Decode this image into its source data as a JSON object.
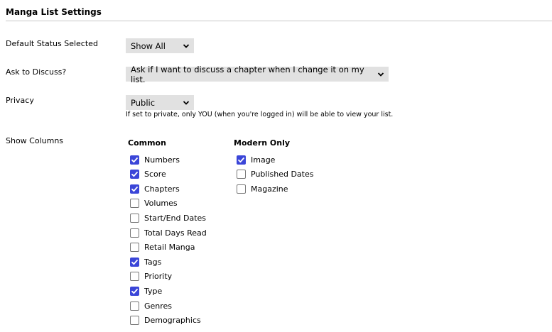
{
  "section_title": "Manga List Settings",
  "default_status": {
    "label": "Default Status Selected",
    "value": "Show All"
  },
  "ask_discuss": {
    "label": "Ask to Discuss?",
    "value": "Ask if I want to discuss a chapter when I change it on my list."
  },
  "privacy": {
    "label": "Privacy",
    "value": "Public",
    "help": "If set to private, only YOU (when you're logged in) will be able to view your list."
  },
  "show_columns": {
    "label": "Show Columns",
    "common": {
      "heading": "Common",
      "items": [
        {
          "label": "Numbers",
          "checked": true
        },
        {
          "label": "Score",
          "checked": true
        },
        {
          "label": "Chapters",
          "checked": true
        },
        {
          "label": "Volumes",
          "checked": false
        },
        {
          "label": "Start/End Dates",
          "checked": false
        },
        {
          "label": "Total Days Read",
          "checked": false
        },
        {
          "label": "Retail Manga",
          "checked": false
        },
        {
          "label": "Tags",
          "checked": true
        },
        {
          "label": "Priority",
          "checked": false
        },
        {
          "label": "Type",
          "checked": true
        },
        {
          "label": "Genres",
          "checked": false
        },
        {
          "label": "Demographics",
          "checked": false
        }
      ]
    },
    "modern": {
      "heading": "Modern Only",
      "items": [
        {
          "label": "Image",
          "checked": true
        },
        {
          "label": "Published Dates",
          "checked": false
        },
        {
          "label": "Magazine",
          "checked": false
        }
      ]
    }
  },
  "colors": {
    "checkbox_checked": "#3b46d8",
    "select_bg": "#e1e1e1",
    "rule": "#c8c8c8"
  }
}
